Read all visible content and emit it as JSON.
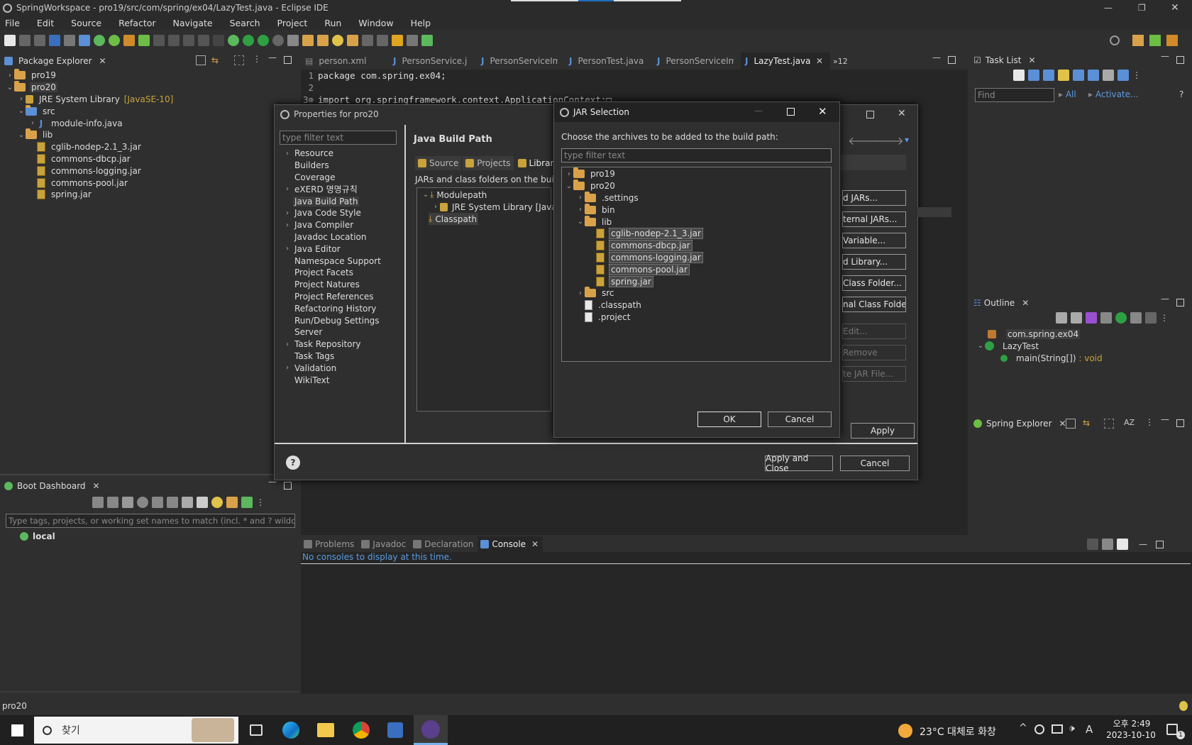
{
  "window": {
    "title": "SpringWorkspace - pro19/src/com/spring/ex04/LazyTest.java - Eclipse IDE"
  },
  "menu": [
    "File",
    "Edit",
    "Source",
    "Refactor",
    "Navigate",
    "Search",
    "Project",
    "Run",
    "Window",
    "Help"
  ],
  "package_explorer": {
    "title": "Package Explorer",
    "items": [
      {
        "label": "pro19",
        "depth": 0,
        "twisty": "›",
        "icon": "folder"
      },
      {
        "label": "pro20",
        "depth": 0,
        "twisty": "⌄",
        "icon": "folder",
        "selected": true
      },
      {
        "label": "JRE System Library",
        "extra": "[JavaSE-10]",
        "depth": 1,
        "twisty": "›",
        "icon": "library"
      },
      {
        "label": "src",
        "depth": 1,
        "twisty": "⌄",
        "icon": "package"
      },
      {
        "label": "module-info.java",
        "depth": 2,
        "twisty": "›",
        "icon": "java"
      },
      {
        "label": "lib",
        "depth": 1,
        "twisty": "⌄",
        "icon": "folder"
      },
      {
        "label": "cglib-nodep-2.1_3.jar",
        "depth": 2,
        "icon": "jar"
      },
      {
        "label": "commons-dbcp.jar",
        "depth": 2,
        "icon": "jar"
      },
      {
        "label": "commons-logging.jar",
        "depth": 2,
        "icon": "jar"
      },
      {
        "label": "commons-pool.jar",
        "depth": 2,
        "icon": "jar"
      },
      {
        "label": "spring.jar",
        "depth": 2,
        "icon": "jar"
      }
    ]
  },
  "editor": {
    "tabs": [
      "person.xml",
      "PersonService.j",
      "PersonServiceIm",
      "PersonTest.java",
      "PersonServiceIm",
      "LazyTest.java"
    ],
    "active_tab": "LazyTest.java",
    "overflow": "»12",
    "lines": [
      {
        "num": "1",
        "code": "package com.spring.ex04;"
      },
      {
        "num": "2",
        "code": ""
      },
      {
        "num": "3⊕",
        "code": "import org.springframework.context.ApplicationContext;□"
      }
    ]
  },
  "task_list": {
    "title": "Task List",
    "find_placeholder": "Find",
    "all": "All",
    "activate": "Activate..."
  },
  "outline": {
    "title": "Outline",
    "items": [
      "com.spring.ex04",
      "LazyTest",
      "main(String[])"
    ],
    "return_type": ": void"
  },
  "spring_explorer": {
    "title": "Spring Explorer"
  },
  "boot_dashboard": {
    "title": "Boot Dashboard",
    "filter_placeholder": "Type tags, projects, or working set names to match (incl. * and ? wildcards)",
    "local": "local"
  },
  "console": {
    "tabs": [
      "Problems",
      "Javadoc",
      "Declaration",
      "Console"
    ],
    "active": "Console",
    "message": "No consoles to display at this time."
  },
  "status_bar": {
    "text": "pro20"
  },
  "properties_dialog": {
    "title": "Properties for pro20",
    "filter_placeholder": "type filter text",
    "heading": "Java Build Path",
    "nav": [
      {
        "label": "Resource",
        "twisty": true
      },
      {
        "label": "Builders"
      },
      {
        "label": "Coverage"
      },
      {
        "label": "eXERD 명명규칙",
        "twisty": true
      },
      {
        "label": "Java Build Path",
        "selected": true
      },
      {
        "label": "Java Code Style",
        "twisty": true
      },
      {
        "label": "Java Compiler",
        "twisty": true
      },
      {
        "label": "Javadoc Location"
      },
      {
        "label": "Java Editor",
        "twisty": true
      },
      {
        "label": "Namespace Support"
      },
      {
        "label": "Project Facets"
      },
      {
        "label": "Project Natures"
      },
      {
        "label": "Project References"
      },
      {
        "label": "Refactoring History"
      },
      {
        "label": "Run/Debug Settings"
      },
      {
        "label": "Server"
      },
      {
        "label": "Task Repository",
        "twisty": true
      },
      {
        "label": "Task Tags"
      },
      {
        "label": "Validation",
        "twisty": true
      },
      {
        "label": "WikiText"
      }
    ],
    "tabs": [
      "Source",
      "Projects",
      "Librarie"
    ],
    "description": "JARs and class folders on the build p",
    "tree": {
      "modulepath": "Modulepath",
      "jre": "JRE System Library [JavaS",
      "classpath": "Classpath"
    },
    "side_buttons": [
      "d JARs...",
      "ternal JARs...",
      "Variable...",
      "d Library...",
      "Class Folder...",
      "nal Class Folder...",
      "Edit...",
      "Remove",
      "te JAR File..."
    ],
    "apply": "Apply",
    "apply_close": "Apply and Close",
    "cancel": "Cancel"
  },
  "jar_dialog": {
    "title": "JAR Selection",
    "prompt": "Choose the archives to be added to the build path:",
    "filter_placeholder": "type filter text",
    "items": [
      {
        "label": "pro19",
        "depth": 0,
        "twisty": "›",
        "icon": "folder"
      },
      {
        "label": "pro20",
        "depth": 0,
        "twisty": "⌄",
        "icon": "folder"
      },
      {
        "label": ".settings",
        "depth": 1,
        "twisty": "›",
        "icon": "folder"
      },
      {
        "label": "bin",
        "depth": 1,
        "twisty": "›",
        "icon": "folder"
      },
      {
        "label": "lib",
        "depth": 1,
        "twisty": "⌄",
        "icon": "folder"
      },
      {
        "label": "cglib-nodep-2.1_3.jar",
        "depth": 2,
        "icon": "jar",
        "selected": true
      },
      {
        "label": "commons-dbcp.jar",
        "depth": 2,
        "icon": "jar",
        "selected": true
      },
      {
        "label": "commons-logging.jar",
        "depth": 2,
        "icon": "jar",
        "selected": true
      },
      {
        "label": "commons-pool.jar",
        "depth": 2,
        "icon": "jar",
        "selected": true
      },
      {
        "label": "spring.jar",
        "depth": 2,
        "icon": "jar",
        "selected": true
      },
      {
        "label": "src",
        "depth": 1,
        "twisty": "›",
        "icon": "folder"
      },
      {
        "label": ".classpath",
        "depth": 1,
        "icon": "file"
      },
      {
        "label": ".project",
        "depth": 1,
        "icon": "file"
      }
    ],
    "ok": "OK",
    "cancel": "Cancel"
  },
  "taskbar": {
    "search": "찾기",
    "weather": "23°C 대체로 화창",
    "time": "오후 2:49",
    "date": "2023-10-10",
    "ime": "A",
    "notif": "1"
  }
}
